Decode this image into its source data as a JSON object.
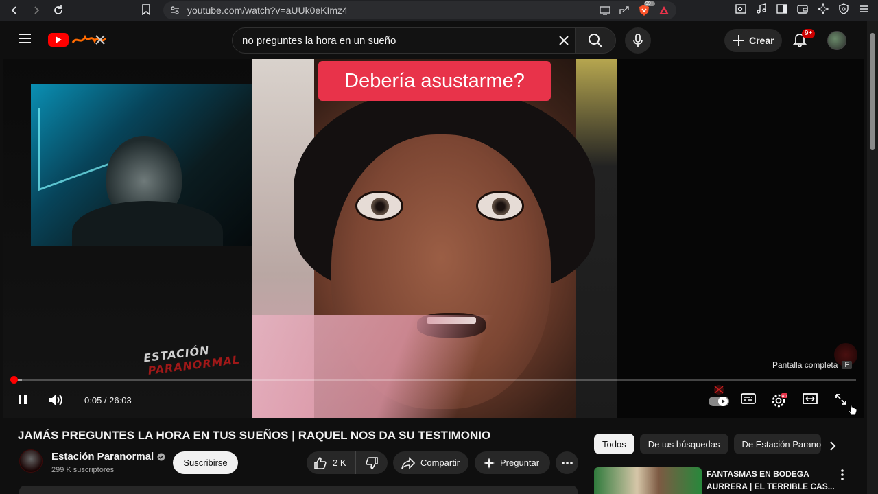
{
  "browser": {
    "url": "youtube.com/watch?v=aUUk0eKImz4",
    "brave_badge": "99+"
  },
  "header": {
    "search_query": "no preguntes la hora en un sueño",
    "create_label": "Crear",
    "notifications_badge": "9+"
  },
  "player": {
    "caption": "Debería asustarme?",
    "watermark_line1": "ESTACIÓN",
    "watermark_line2": "PARANORMAL",
    "fullscreen_tooltip": "Pantalla completa",
    "fullscreen_key": "F",
    "current_time": "0:05",
    "time_sep": " / ",
    "duration": "26:03",
    "played_fraction": 0.0032,
    "buffered_fraction": 0.013,
    "quality_badge": "HD"
  },
  "video": {
    "title": "JAMÁS PREGUNTES LA HORA EN TUS SUEÑOS | RAQUEL NOS DA SU TESTIMONIO",
    "channel_name": "Estación Paranormal",
    "subscribers": "299 K suscriptores",
    "subscribe_label": "Suscribirse",
    "likes": "2 K",
    "share_label": "Compartir",
    "ask_label": "Preguntar"
  },
  "sidebar": {
    "chips": [
      "Todos",
      "De tus búsquedas",
      "De Estación Paranormal"
    ],
    "recommendation_title": "FANTASMAS EN BODEGA AURRERA | EL TERRIBLE CAS..."
  },
  "colors": {
    "brand_red": "#ff0000",
    "caption_bg": "#e8334a",
    "bg": "#0f0f0f"
  }
}
